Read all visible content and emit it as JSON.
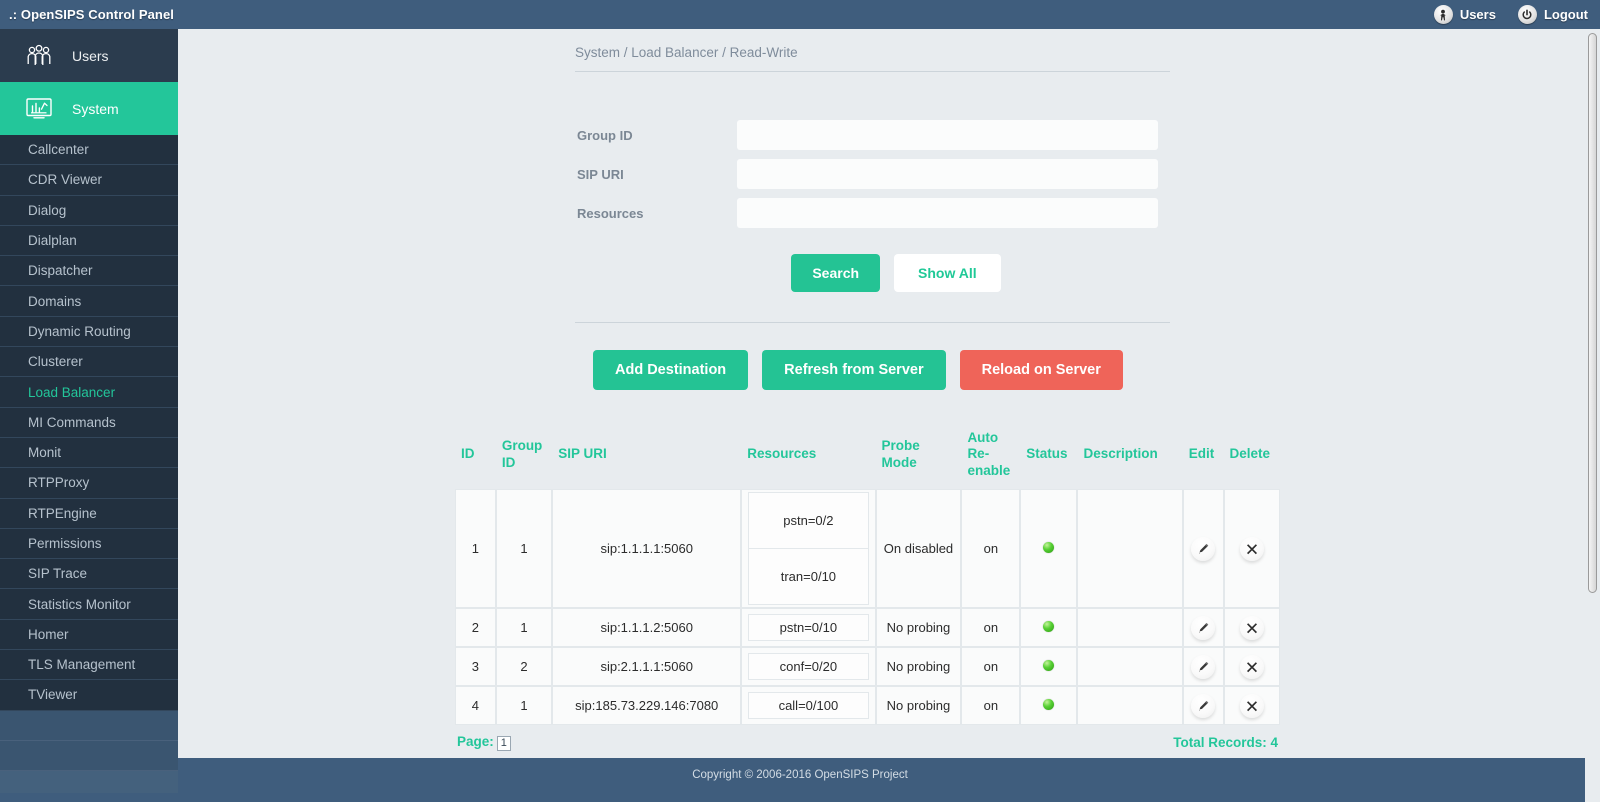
{
  "topbar": {
    "brand": ".: OpenSIPS Control Panel",
    "users_label": "Users",
    "logout_label": "Logout",
    "users_icon": "person-icon",
    "logout_icon": "power-icon",
    "bg_color": "#3f5d7d"
  },
  "sidebar": {
    "main": [
      {
        "label": "Users",
        "icon": "users-group-icon",
        "active": false
      },
      {
        "label": "System",
        "icon": "monitor-chart-icon",
        "active": true
      }
    ],
    "items": [
      {
        "label": "Callcenter",
        "selected": false
      },
      {
        "label": "CDR Viewer",
        "selected": false
      },
      {
        "label": "Dialog",
        "selected": false
      },
      {
        "label": "Dialplan",
        "selected": false
      },
      {
        "label": "Dispatcher",
        "selected": false
      },
      {
        "label": "Domains",
        "selected": false
      },
      {
        "label": "Dynamic Routing",
        "selected": false
      },
      {
        "label": "Clusterer",
        "selected": false
      },
      {
        "label": "Load Balancer",
        "selected": true
      },
      {
        "label": "MI Commands",
        "selected": false
      },
      {
        "label": "Monit",
        "selected": false
      },
      {
        "label": "RTPProxy",
        "selected": false
      },
      {
        "label": "RTPEngine",
        "selected": false
      },
      {
        "label": "Permissions",
        "selected": false
      },
      {
        "label": "SIP Trace",
        "selected": false
      },
      {
        "label": "Statistics Monitor",
        "selected": false
      },
      {
        "label": "Homer",
        "selected": false
      },
      {
        "label": "TLS Management",
        "selected": false
      },
      {
        "label": "TViewer",
        "selected": false
      }
    ],
    "accent_color": "#23c69a",
    "bg_color": "#22303f"
  },
  "breadcrumb": "System / Load Balancer / Read-Write",
  "search_form": {
    "fields": [
      {
        "label": "Group ID",
        "value": "",
        "placeholder": ""
      },
      {
        "label": "SIP URI",
        "value": "",
        "placeholder": ""
      },
      {
        "label": "Resources",
        "value": "",
        "placeholder": ""
      }
    ],
    "search_label": "Search",
    "show_all_label": "Show All"
  },
  "actions": {
    "add_destination": "Add Destination",
    "refresh_from_server": "Refresh from Server",
    "reload_on_server": "Reload on Server",
    "green_color": "#24c394",
    "red_color": "#ef6459"
  },
  "table": {
    "headers": [
      "ID",
      "Group ID",
      "SIP URI",
      "Resources",
      "Probe Mode",
      "Auto Re-enable",
      "Status",
      "Description",
      "Edit",
      "Delete"
    ],
    "rows": [
      {
        "id": "1",
        "group_id": "1",
        "sip_uri": "sip:1.1.1.1:5060",
        "resources": [
          "pstn=0/2",
          "tran=0/10"
        ],
        "probe_mode": "On disabled",
        "auto_reenable": "on",
        "status": "up",
        "description": "",
        "edit_icon": "pencil-icon",
        "delete_icon": "x-cross-icon"
      },
      {
        "id": "2",
        "group_id": "1",
        "sip_uri": "sip:1.1.1.2:5060",
        "resources": [
          "pstn=0/10"
        ],
        "probe_mode": "No probing",
        "auto_reenable": "on",
        "status": "up",
        "description": "",
        "edit_icon": "pencil-icon",
        "delete_icon": "x-cross-icon"
      },
      {
        "id": "3",
        "group_id": "2",
        "sip_uri": "sip:2.1.1.1:5060",
        "resources": [
          "conf=0/20"
        ],
        "probe_mode": "No probing",
        "auto_reenable": "on",
        "status": "up",
        "description": "",
        "edit_icon": "pencil-icon",
        "delete_icon": "x-cross-icon"
      },
      {
        "id": "4",
        "group_id": "1",
        "sip_uri": "sip:185.73.229.146:7080",
        "resources": [
          "call=0/100"
        ],
        "probe_mode": "No probing",
        "auto_reenable": "on",
        "status": "up",
        "description": "",
        "edit_icon": "pencil-icon",
        "delete_icon": "x-cross-icon"
      }
    ],
    "page_label": "Page:",
    "page_number": "1",
    "total_records": "Total Records: 4"
  },
  "footer": {
    "copyright": "Copyright © 2006-2016 OpenSIPS Project"
  }
}
